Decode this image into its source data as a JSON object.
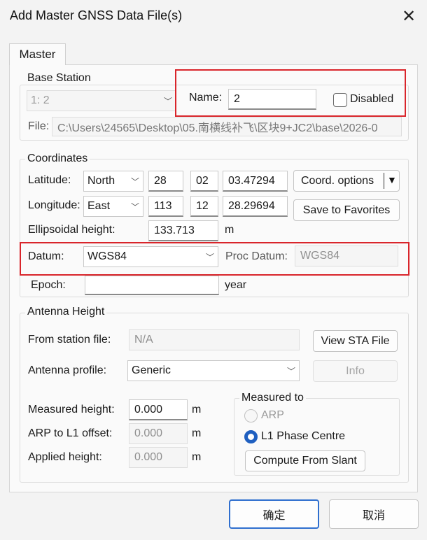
{
  "window": {
    "title": "Add Master GNSS Data File(s)",
    "close_glyph": "✕"
  },
  "tabs": [
    {
      "label": "Master"
    }
  ],
  "base_station": {
    "legend": "Base Station",
    "station_select": "1: 2",
    "name_label": "Name:",
    "name_value": "2",
    "disabled_label": "Disabled",
    "file_label": "File:",
    "file_path": "C:\\Users\\24565\\Desktop\\05.南横线补飞\\区块9+JC2\\base\\2026-0"
  },
  "coordinates": {
    "legend": "Coordinates",
    "latitude_label": "Latitude:",
    "lat_hemisphere": "North",
    "lat_deg": "28",
    "lat_min": "02",
    "lat_sec": "03.47294",
    "longitude_label": "Longitude:",
    "lon_hemisphere": "East",
    "lon_deg": "113",
    "lon_min": "12",
    "lon_sec": "28.29694",
    "height_label": "Ellipsoidal height:",
    "height_value": "133.713",
    "height_unit": "m",
    "coord_options_label": "Coord. options",
    "save_favorites_label": "Save to Favorites",
    "datum_label": "Datum:",
    "datum_value": "WGS84",
    "proc_datum_label": "Proc Datum:",
    "proc_datum_value": "WGS84",
    "epoch_label": "Epoch:",
    "epoch_value": "",
    "epoch_unit": "year"
  },
  "antenna": {
    "legend": "Antenna Height",
    "from_station_label": "From station file:",
    "from_station_value": "N/A",
    "view_sta_label": "View STA File",
    "profile_label": "Antenna profile:",
    "profile_value": "Generic",
    "info_label": "Info",
    "measured_label": "Measured height:",
    "measured_value": "0.000",
    "arp_offset_label": "ARP to L1 offset:",
    "arp_offset_value": "0.000",
    "applied_label": "Applied height:",
    "applied_value": "0.000",
    "unit": "m",
    "measured_to_legend": "Measured to",
    "arp_radio_label": "ARP",
    "l1_radio_label": "L1 Phase Centre",
    "compute_slant_label": "Compute From Slant"
  },
  "footer": {
    "ok_label": "确定",
    "cancel_label": "取消"
  },
  "colors": {
    "highlight_red": "#d9252b",
    "accent_blue": "#1f5fc0"
  }
}
